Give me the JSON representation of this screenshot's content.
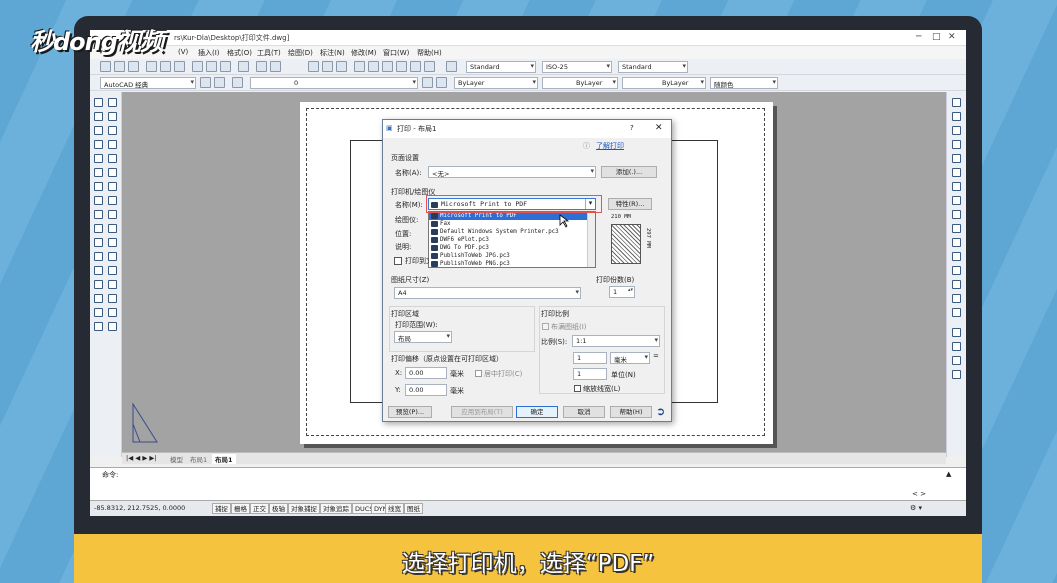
{
  "watermark": "秒dong视频",
  "subtitle": "选择打印机，选择“PDF”",
  "window": {
    "title": "rs\\Kur-Dla\\Desktop\\打印文件.dwg]"
  },
  "menu": [
    "(V)",
    "插入(I)",
    "格式(O)",
    "工具(T)",
    "绘图(D)",
    "标注(N)",
    "修改(M)",
    "窗口(W)",
    "帮助(H)"
  ],
  "toolbar": {
    "text_style": "Standard",
    "dim_style": "ISO-25",
    "table_style": "Standard",
    "workspace": "AutoCAD 经典",
    "layer": "0",
    "color": "ByLayer",
    "linetype": "ByLayer",
    "lineweight": "ByLayer",
    "plotstyle": "随颜色"
  },
  "tabs": [
    "模型",
    "布局1",
    "布局1"
  ],
  "command": {
    "prompt": "命令:"
  },
  "status": {
    "coords": "-85.8312, 212.7525, 0.0000",
    "buttons": [
      "捕捉",
      "栅格",
      "正交",
      "极轴",
      "对象捕捉",
      "对象追踪",
      "DUCS",
      "DYN",
      "线宽",
      "图纸"
    ]
  },
  "dialog": {
    "title": "打印 - 布局1",
    "help_link": "了解打印",
    "page_setup": {
      "label": "页面设置",
      "name_label": "名称(A):",
      "name_value": "<无>",
      "add_btn": "添加(.)..."
    },
    "printer": {
      "label": "打印机/绘图仪",
      "name_label": "名称(M):",
      "selected": "Microsoft Print to PDF",
      "props_btn": "特性(R)...",
      "plotter_label": "绘图仪:",
      "where_label": "位置:",
      "desc_label": "说明:",
      "print_to_file": "打印到文件",
      "options": [
        "Microsoft Print to PDF",
        "Fax",
        "Default Windows System Printer.pc3",
        "DWF6 ePlot.pc3",
        "DWG To PDF.pc3",
        "PublishToWeb JPG.pc3",
        "PublishToWeb PNG.pc3"
      ],
      "preview_dim_w": "210 MM",
      "preview_dim_h": "297 MM"
    },
    "paper_size": {
      "label": "图纸尺寸(Z)",
      "value": "A4"
    },
    "copies": {
      "label": "打印份数(B)",
      "value": "1"
    },
    "plot_area": {
      "label": "打印区域",
      "range_label": "打印范围(W):",
      "range_value": "布局"
    },
    "plot_scale": {
      "label": "打印比例",
      "fit": "布满图纸(I)",
      "scale_label": "比例(S):",
      "scale_value": "1:1",
      "v1": "1",
      "unit": "毫米",
      "v2": "1",
      "unit_label": "单位(N)",
      "lw": "缩放线宽(L)"
    },
    "offset": {
      "label": "打印偏移（原点设置在可打印区域）",
      "x_label": "X:",
      "x_value": "0.00",
      "y_label": "Y:",
      "y_value": "0.00",
      "mm": "毫米",
      "center": "居中打印(C)"
    },
    "buttons": {
      "preview": "预览(P)...",
      "apply": "应用到布局(T)",
      "ok": "确定",
      "cancel": "取消",
      "help": "帮助(H)"
    }
  }
}
